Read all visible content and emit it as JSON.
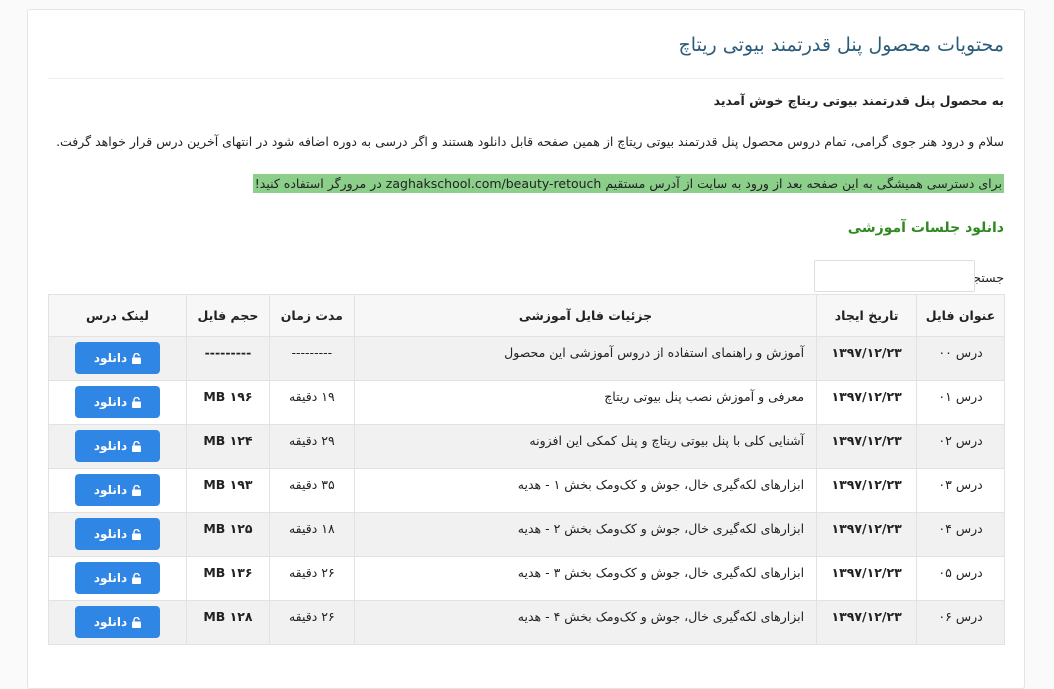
{
  "page": {
    "title": "محتویات محصول پنل قدرتمند بیوتی ریتاچ",
    "welcome": "به محصول پنل قدرتمند بیوتی ریتاچ خوش آمدید",
    "greeting": "سلام و درود هنر جوی گرامی، تمام دروس محصول پنل قدرتمند بیوتی ریتاچ از همین صفحه قابل دانلود هستند و اگر درسی به دوره اضافه شود در انتهای آخرین درس قرار خواهد گرفت.",
    "notice": "برای دسترسی همیشگی به این صفحه بعد از ورود به سایت از آدرس مستقیم zaghakschool.com/beauty-retouch در مرورگر استفاده کنید!",
    "section_title": "دانلود جلسات آموزشی",
    "highlight_color": "#8bcf8b",
    "accent_color": "#2f86e5"
  },
  "search": {
    "label": "جستجو:",
    "value": ""
  },
  "table": {
    "headers": {
      "title": "عنوان فایل",
      "date": "تاریخ ایجاد",
      "detail": "جزئیات فایل آموزشی",
      "duration": "مدت زمان",
      "size": "حجم فایل",
      "link": "لینک درس"
    },
    "rows": [
      {
        "title": "درس ۰۰",
        "date": "۱۳۹۷/۱۲/۲۳",
        "detail": "آموزش و راهنمای استفاده از دروس آموزشی این محصول",
        "duration": "---------",
        "size": "---------",
        "link": "دانلود"
      },
      {
        "title": "درس ۰۱",
        "date": "۱۳۹۷/۱۲/۲۳",
        "detail": "معرفی و آموزش نصب پنل بیوتی ریتاچ",
        "duration": "۱۹ دقیقه",
        "size": "MB ۱۹۶",
        "link": "دانلود"
      },
      {
        "title": "درس ۰۲",
        "date": "۱۳۹۷/۱۲/۲۳",
        "detail": "آشنایی کلی با پنل بیوتی ریتاچ و پنل کمکی این افزونه",
        "duration": "۲۹ دقیقه",
        "size": "MB ۱۲۴",
        "link": "دانلود"
      },
      {
        "title": "درس ۰۳",
        "date": "۱۳۹۷/۱۲/۲۳",
        "detail": "ابزارهای لکه‌گیری خال، جوش و کک‌ومک بخش ۱ - هدیه",
        "duration": "۳۵ دقیقه",
        "size": "MB ۱۹۳",
        "link": "دانلود"
      },
      {
        "title": "درس ۰۴",
        "date": "۱۳۹۷/۱۲/۲۳",
        "detail": "ابزارهای لکه‌گیری خال، جوش و کک‌ومک بخش ۲ - هدیه",
        "duration": "۱۸ دقیقه",
        "size": "MB ۱۲۵",
        "link": "دانلود"
      },
      {
        "title": "درس ۰۵",
        "date": "۱۳۹۷/۱۲/۲۳",
        "detail": "ابزارهای لکه‌گیری خال، جوش و کک‌ومک بخش ۳ - هدیه",
        "duration": "۲۶ دقیقه",
        "size": "MB ۱۳۶",
        "link": "دانلود"
      },
      {
        "title": "درس ۰۶",
        "date": "۱۳۹۷/۱۲/۲۳",
        "detail": "ابزارهای لکه‌گیری خال، جوش و کک‌ومک بخش ۴ - هدیه",
        "duration": "۲۶ دقیقه",
        "size": "MB ۱۲۸",
        "link": "دانلود"
      }
    ]
  }
}
